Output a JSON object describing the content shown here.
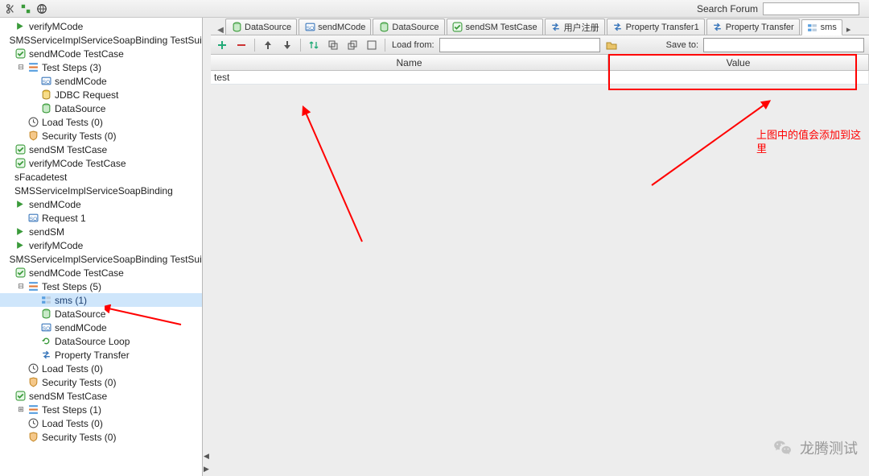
{
  "topbar": {
    "search_label": "Search Forum",
    "search_value": ""
  },
  "tree": [
    {
      "indent": 0,
      "icon": "arrow-right-green",
      "label": "verifyMCode"
    },
    {
      "indent": 0,
      "icon": "none",
      "label": "SMSServiceImplServiceSoapBinding TestSuit"
    },
    {
      "indent": 0,
      "icon": "check-green",
      "label": "sendMCode TestCase"
    },
    {
      "indent": 1,
      "toggle": "minus",
      "icon": "steps",
      "label": "Test Steps (3)"
    },
    {
      "indent": 2,
      "icon": "soap",
      "label": "sendMCode"
    },
    {
      "indent": 2,
      "icon": "jdbc",
      "label": "JDBC Request"
    },
    {
      "indent": 2,
      "icon": "datasource",
      "label": "DataSource"
    },
    {
      "indent": 1,
      "icon": "clock",
      "label": "Load Tests (0)"
    },
    {
      "indent": 1,
      "icon": "shield",
      "label": "Security Tests (0)"
    },
    {
      "indent": 0,
      "icon": "check-green",
      "label": "sendSM TestCase"
    },
    {
      "indent": 0,
      "icon": "check-green",
      "label": "verifyMCode TestCase"
    },
    {
      "indent": 0,
      "icon": "none",
      "label": "sFacadetest",
      "noIcon": true
    },
    {
      "indent": 0,
      "icon": "none",
      "label": "SMSServiceImplServiceSoapBinding",
      "noIcon": true
    },
    {
      "indent": 0,
      "icon": "arrow-right-green",
      "label": "sendMCode"
    },
    {
      "indent": 1,
      "icon": "soap",
      "label": "Request 1"
    },
    {
      "indent": 0,
      "icon": "arrow-right-green",
      "label": "sendSM"
    },
    {
      "indent": 0,
      "icon": "arrow-right-green",
      "label": "verifyMCode"
    },
    {
      "indent": 0,
      "icon": "none",
      "label": "SMSServiceImplServiceSoapBinding TestSuit"
    },
    {
      "indent": 0,
      "icon": "check-green",
      "label": "sendMCode TestCase"
    },
    {
      "indent": 1,
      "toggle": "minus",
      "icon": "steps",
      "label": "Test Steps (5)"
    },
    {
      "indent": 2,
      "icon": "props",
      "label": "sms (1)",
      "selected": true
    },
    {
      "indent": 2,
      "icon": "datasource",
      "label": "DataSource"
    },
    {
      "indent": 2,
      "icon": "soap",
      "label": "sendMCode"
    },
    {
      "indent": 2,
      "icon": "loop",
      "label": "DataSource Loop"
    },
    {
      "indent": 2,
      "icon": "transfer",
      "label": "Property Transfer"
    },
    {
      "indent": 1,
      "icon": "clock",
      "label": "Load Tests (0)"
    },
    {
      "indent": 1,
      "icon": "shield",
      "label": "Security Tests (0)"
    },
    {
      "indent": 0,
      "icon": "check-green",
      "label": "sendSM TestCase"
    },
    {
      "indent": 1,
      "toggle": "plus",
      "icon": "steps",
      "label": "Test Steps (1)"
    },
    {
      "indent": 1,
      "icon": "clock",
      "label": "Load Tests (0)"
    },
    {
      "indent": 1,
      "icon": "shield",
      "label": "Security Tests (0)"
    }
  ],
  "tabs": [
    {
      "icon": "datasource",
      "label": "DataSource"
    },
    {
      "icon": "soap",
      "label": "sendMCode"
    },
    {
      "icon": "datasource",
      "label": "DataSource"
    },
    {
      "icon": "check-green",
      "label": "sendSM TestCase"
    },
    {
      "icon": "transfer",
      "label": "用户注册"
    },
    {
      "icon": "transfer",
      "label": "Property Transfer1"
    },
    {
      "icon": "transfer",
      "label": "Property Transfer"
    },
    {
      "icon": "props",
      "label": "sms",
      "active": true
    }
  ],
  "toolbar": {
    "load_from": "Load from:",
    "load_value": "",
    "save_to": "Save to:",
    "save_value": ""
  },
  "grid": {
    "head_name": "Name",
    "head_value": "Value",
    "rows": [
      {
        "name": "test",
        "value": ""
      }
    ]
  },
  "annotations": {
    "note1": "上图中的值会添加到这里"
  },
  "watermark": {
    "text": "龙腾测试"
  }
}
